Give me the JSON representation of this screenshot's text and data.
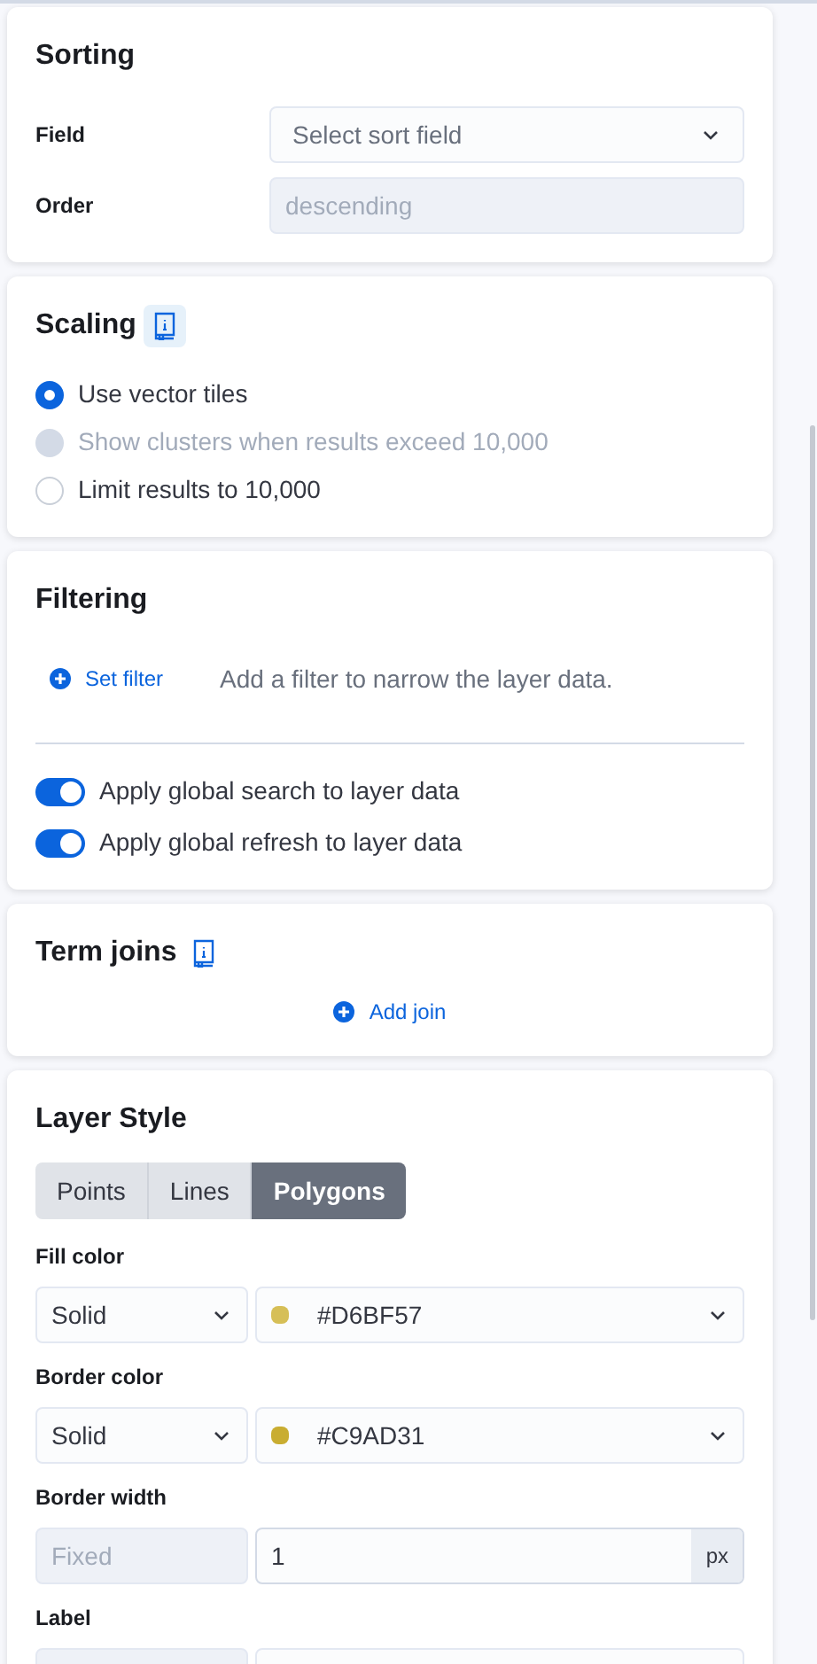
{
  "sorting": {
    "title": "Sorting",
    "fields": [
      {
        "label": "Field",
        "placeholder": "Select sort field",
        "disabled": false
      },
      {
        "label": "Order",
        "value": "descending",
        "disabled": true
      }
    ]
  },
  "scaling": {
    "title": "Scaling",
    "options": [
      {
        "label": "Use vector tiles",
        "selected": true,
        "disabled": false
      },
      {
        "label": "Show clusters when results exceed 10,000",
        "selected": false,
        "disabled": true
      },
      {
        "label": "Limit results to 10,000",
        "selected": false,
        "disabled": false
      }
    ]
  },
  "filtering": {
    "title": "Filtering",
    "set_filter": "Set filter",
    "hint": "Add a filter to narrow the layer data.",
    "switches": [
      {
        "label": "Apply global search to layer data",
        "on": true
      },
      {
        "label": "Apply global refresh to layer data",
        "on": true
      }
    ]
  },
  "term_joins": {
    "title": "Term joins",
    "add_join": "Add join"
  },
  "layer_style": {
    "title": "Layer Style",
    "tabs": [
      {
        "label": "Points",
        "selected": false
      },
      {
        "label": "Lines",
        "selected": false
      },
      {
        "label": "Polygons",
        "selected": true
      }
    ],
    "properties": [
      {
        "kind": "color",
        "label": "Fill color",
        "mode": "Solid",
        "color": "#d6bf57",
        "value": "#D6BF57"
      },
      {
        "kind": "color",
        "label": "Border color",
        "mode": "Solid",
        "color": "#c9ad31",
        "value": "#C9AD31"
      },
      {
        "kind": "number",
        "label": "Border width",
        "mode": "Fixed",
        "value": "1",
        "unit": "px"
      },
      {
        "kind": "cut",
        "label": "Label"
      }
    ]
  }
}
